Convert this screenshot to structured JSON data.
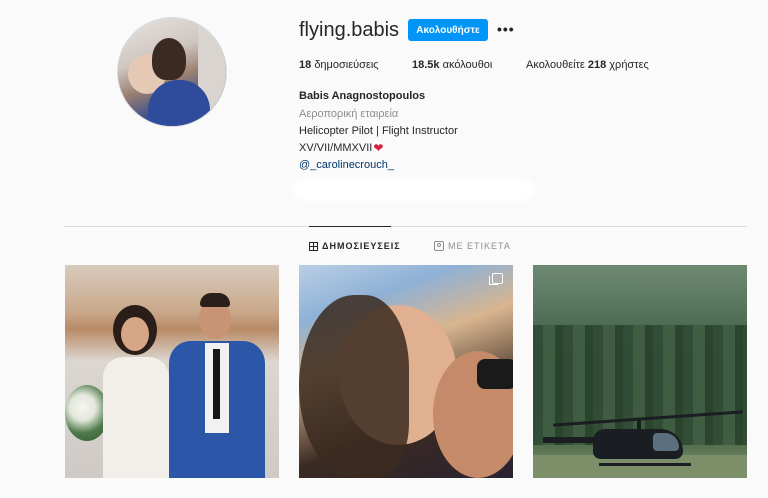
{
  "profile": {
    "username": "flying.babis",
    "follow_label": "Ακολουθήστε",
    "more_label": "•••",
    "full_name": "Babis Anagnostopoulos",
    "category": "Αεροπορική εταιρεία",
    "bio_line1": "Helicopter Pilot | Flight Instructor",
    "bio_line2": "XV/VII/MMXVII",
    "heart": "❤",
    "mention": "@_carolinecrouch_"
  },
  "stats": {
    "posts_count": "18",
    "posts_label": "δημοσιεύσεις",
    "followers_count": "18.5k",
    "followers_label": "ακόλουθοι",
    "following_prefix": "Ακολουθείτε",
    "following_count": "218",
    "following_label": "χρήστες"
  },
  "tabs": [
    {
      "label": "ΔΗΜΟΣΙΕΥΣΕΙΣ",
      "icon": "grid-icon",
      "active": true
    },
    {
      "label": "ΜΕ ΕΤΙΚΕΤΑ",
      "icon": "tag-icon",
      "active": false
    }
  ],
  "posts": [
    {
      "subject": "wedding-couple-beach"
    },
    {
      "subject": "couple-selfie",
      "multi": true
    },
    {
      "subject": "helicopter-forest"
    }
  ]
}
